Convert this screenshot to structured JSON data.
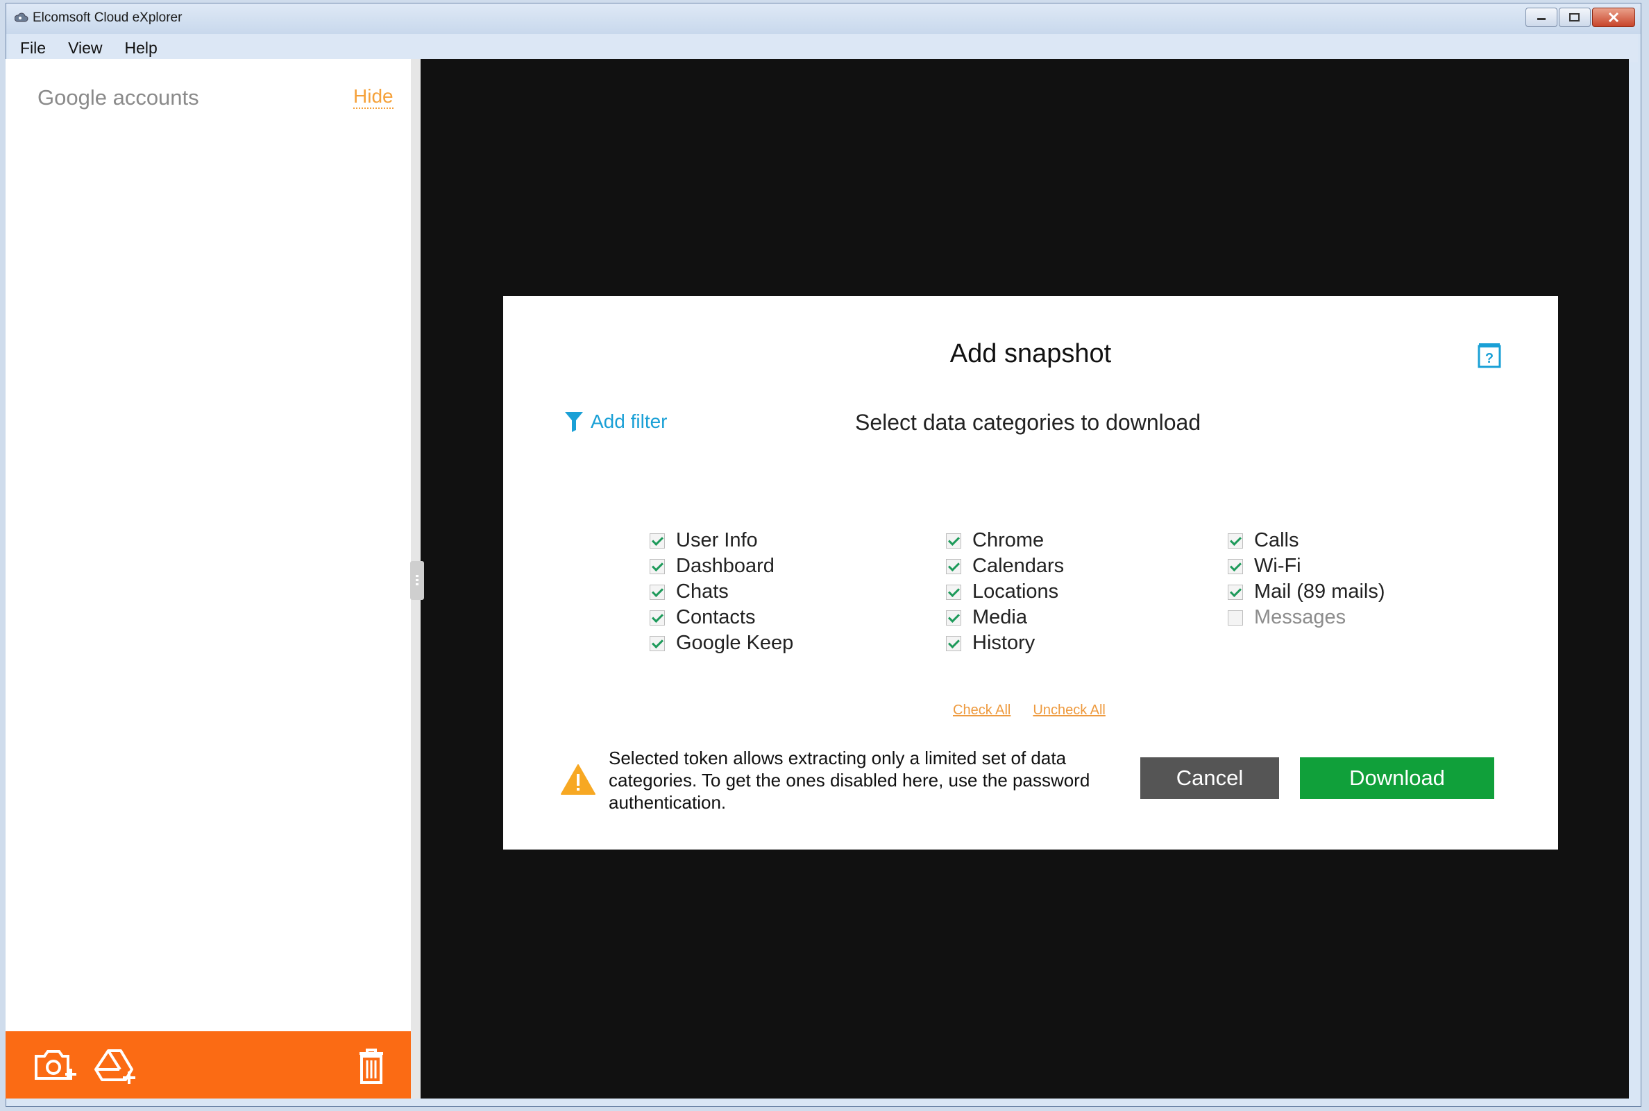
{
  "window": {
    "title": "Elcomsoft Cloud eXplorer"
  },
  "menu": [
    "File",
    "View",
    "Help"
  ],
  "sidebar": {
    "title": "Google accounts",
    "hide_label": "Hide"
  },
  "dialog": {
    "title": "Add snapshot",
    "add_filter_label": "Add filter",
    "select_label": "Select data categories to download",
    "categories": [
      {
        "label": "User Info",
        "checked": true,
        "enabled": true
      },
      {
        "label": "Dashboard",
        "checked": true,
        "enabled": true
      },
      {
        "label": "Chats",
        "checked": true,
        "enabled": true
      },
      {
        "label": "Contacts",
        "checked": true,
        "enabled": true
      },
      {
        "label": "Google Keep",
        "checked": true,
        "enabled": true
      },
      {
        "label": "Chrome",
        "checked": true,
        "enabled": true
      },
      {
        "label": "Calendars",
        "checked": true,
        "enabled": true
      },
      {
        "label": "Locations",
        "checked": true,
        "enabled": true
      },
      {
        "label": "Media",
        "checked": true,
        "enabled": true
      },
      {
        "label": "History",
        "checked": true,
        "enabled": true
      },
      {
        "label": "Calls",
        "checked": true,
        "enabled": true
      },
      {
        "label": "Wi-Fi",
        "checked": true,
        "enabled": true
      },
      {
        "label": "Mail (89 mails)",
        "checked": true,
        "enabled": true
      },
      {
        "label": "Messages",
        "checked": false,
        "enabled": false
      }
    ],
    "check_all_label": "Check All",
    "uncheck_all_label": "Uncheck All",
    "warning_text": "Selected token allows extracting only a limited set of data categories. To get the ones disabled here, use the password authentication.",
    "cancel_label": "Cancel",
    "download_label": "Download"
  },
  "icons": {
    "app": "cloud-icon",
    "filter": "funnel-icon",
    "help": "help-book-icon",
    "warning": "warning-triangle-icon",
    "add_snapshot": "camera-plus-icon",
    "add_drive": "drive-plus-icon",
    "delete": "trash-icon"
  },
  "colors": {
    "accent_orange": "#fb6b14",
    "link_blue": "#1aa0d6",
    "download_green": "#10a03a",
    "cancel_gray": "#555555",
    "hide_link": "#f5a13a"
  }
}
